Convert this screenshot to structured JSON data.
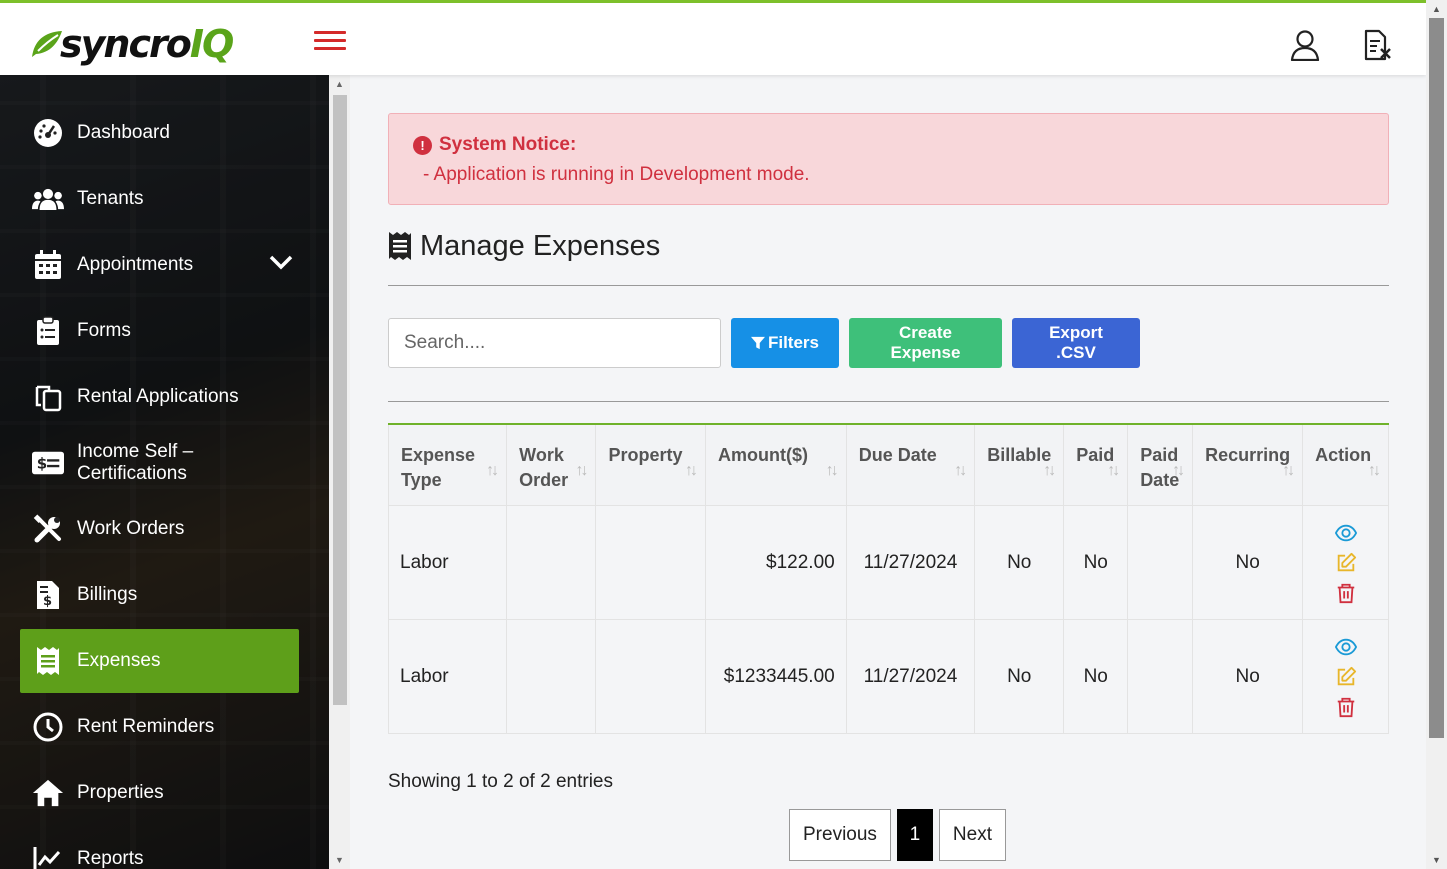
{
  "header": {
    "logo_main": "syncro",
    "logo_accent": "IQ",
    "icons": [
      "menu-icon",
      "user-icon",
      "document-icon"
    ]
  },
  "sidebar": {
    "items": [
      {
        "label": "Dashboard",
        "icon": "dashboard-icon"
      },
      {
        "label": "Tenants",
        "icon": "users-icon"
      },
      {
        "label": "Appointments",
        "icon": "calendar-icon",
        "expandable": true
      },
      {
        "label": "Forms",
        "icon": "clipboard-icon"
      },
      {
        "label": "Rental Applications",
        "icon": "copy-icon"
      },
      {
        "label": "Income Self – Certifications",
        "icon": "money-icon"
      },
      {
        "label": "Work Orders",
        "icon": "tools-icon"
      },
      {
        "label": "Billings",
        "icon": "invoice-icon"
      },
      {
        "label": "Expenses",
        "icon": "receipt-icon",
        "active": true
      },
      {
        "label": "Rent Reminders",
        "icon": "clock-icon"
      },
      {
        "label": "Properties",
        "icon": "home-icon"
      },
      {
        "label": "Reports",
        "icon": "chart-line-icon"
      }
    ]
  },
  "notice": {
    "title": "System Notice:",
    "message": "- Application is running in Development mode."
  },
  "page": {
    "title": "Manage Expenses"
  },
  "toolbar": {
    "search_placeholder": "Search....",
    "filters_label": "Filters",
    "create_label": "Create Expense",
    "export_label": "Export .CSV"
  },
  "table": {
    "columns": [
      "Expense Type",
      "Work Order",
      "Property",
      "Amount($)",
      "Due Date",
      "Billable",
      "Paid",
      "Paid Date",
      "Recurring",
      "Action"
    ],
    "rows": [
      {
        "expense_type": "Labor",
        "work_order": "",
        "property": "",
        "amount": "$122.00",
        "due_date": "11/27/2024",
        "billable": "No",
        "paid": "No",
        "paid_date": "",
        "recurring": "No"
      },
      {
        "expense_type": "Labor",
        "work_order": "",
        "property": "",
        "amount": "$1233445.00",
        "due_date": "11/27/2024",
        "billable": "No",
        "paid": "No",
        "paid_date": "",
        "recurring": "No"
      }
    ]
  },
  "footer": {
    "info": "Showing 1 to 2 of 2 entries",
    "previous": "Previous",
    "current_page": "1",
    "next": "Next"
  },
  "colors": {
    "brand_green": "#5e9f1a",
    "top_border": "#7dc02a",
    "notice_bg": "#f8d7da",
    "notice_text": "#d0303f",
    "filter_btn": "#1690e6",
    "create_btn": "#3ec07a",
    "export_btn": "#3b65d4"
  }
}
